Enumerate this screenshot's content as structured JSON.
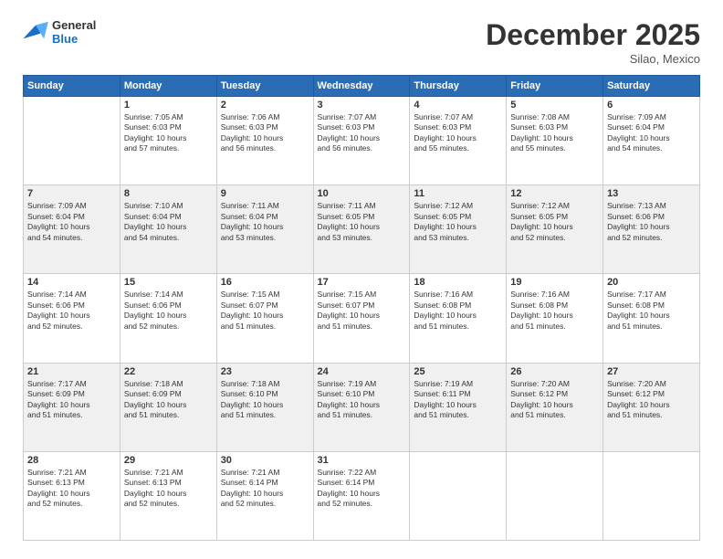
{
  "header": {
    "logo_text_general": "General",
    "logo_text_blue": "Blue",
    "month_title": "December 2025",
    "location": "Silao, Mexico"
  },
  "days_of_week": [
    "Sunday",
    "Monday",
    "Tuesday",
    "Wednesday",
    "Thursday",
    "Friday",
    "Saturday"
  ],
  "weeks": [
    [
      {
        "day": "",
        "info": ""
      },
      {
        "day": "1",
        "info": "Sunrise: 7:05 AM\nSunset: 6:03 PM\nDaylight: 10 hours\nand 57 minutes."
      },
      {
        "day": "2",
        "info": "Sunrise: 7:06 AM\nSunset: 6:03 PM\nDaylight: 10 hours\nand 56 minutes."
      },
      {
        "day": "3",
        "info": "Sunrise: 7:07 AM\nSunset: 6:03 PM\nDaylight: 10 hours\nand 56 minutes."
      },
      {
        "day": "4",
        "info": "Sunrise: 7:07 AM\nSunset: 6:03 PM\nDaylight: 10 hours\nand 55 minutes."
      },
      {
        "day": "5",
        "info": "Sunrise: 7:08 AM\nSunset: 6:03 PM\nDaylight: 10 hours\nand 55 minutes."
      },
      {
        "day": "6",
        "info": "Sunrise: 7:09 AM\nSunset: 6:04 PM\nDaylight: 10 hours\nand 54 minutes."
      }
    ],
    [
      {
        "day": "7",
        "info": "Sunrise: 7:09 AM\nSunset: 6:04 PM\nDaylight: 10 hours\nand 54 minutes."
      },
      {
        "day": "8",
        "info": "Sunrise: 7:10 AM\nSunset: 6:04 PM\nDaylight: 10 hours\nand 54 minutes."
      },
      {
        "day": "9",
        "info": "Sunrise: 7:11 AM\nSunset: 6:04 PM\nDaylight: 10 hours\nand 53 minutes."
      },
      {
        "day": "10",
        "info": "Sunrise: 7:11 AM\nSunset: 6:05 PM\nDaylight: 10 hours\nand 53 minutes."
      },
      {
        "day": "11",
        "info": "Sunrise: 7:12 AM\nSunset: 6:05 PM\nDaylight: 10 hours\nand 53 minutes."
      },
      {
        "day": "12",
        "info": "Sunrise: 7:12 AM\nSunset: 6:05 PM\nDaylight: 10 hours\nand 52 minutes."
      },
      {
        "day": "13",
        "info": "Sunrise: 7:13 AM\nSunset: 6:06 PM\nDaylight: 10 hours\nand 52 minutes."
      }
    ],
    [
      {
        "day": "14",
        "info": "Sunrise: 7:14 AM\nSunset: 6:06 PM\nDaylight: 10 hours\nand 52 minutes."
      },
      {
        "day": "15",
        "info": "Sunrise: 7:14 AM\nSunset: 6:06 PM\nDaylight: 10 hours\nand 52 minutes."
      },
      {
        "day": "16",
        "info": "Sunrise: 7:15 AM\nSunset: 6:07 PM\nDaylight: 10 hours\nand 51 minutes."
      },
      {
        "day": "17",
        "info": "Sunrise: 7:15 AM\nSunset: 6:07 PM\nDaylight: 10 hours\nand 51 minutes."
      },
      {
        "day": "18",
        "info": "Sunrise: 7:16 AM\nSunset: 6:08 PM\nDaylight: 10 hours\nand 51 minutes."
      },
      {
        "day": "19",
        "info": "Sunrise: 7:16 AM\nSunset: 6:08 PM\nDaylight: 10 hours\nand 51 minutes."
      },
      {
        "day": "20",
        "info": "Sunrise: 7:17 AM\nSunset: 6:08 PM\nDaylight: 10 hours\nand 51 minutes."
      }
    ],
    [
      {
        "day": "21",
        "info": "Sunrise: 7:17 AM\nSunset: 6:09 PM\nDaylight: 10 hours\nand 51 minutes."
      },
      {
        "day": "22",
        "info": "Sunrise: 7:18 AM\nSunset: 6:09 PM\nDaylight: 10 hours\nand 51 minutes."
      },
      {
        "day": "23",
        "info": "Sunrise: 7:18 AM\nSunset: 6:10 PM\nDaylight: 10 hours\nand 51 minutes."
      },
      {
        "day": "24",
        "info": "Sunrise: 7:19 AM\nSunset: 6:10 PM\nDaylight: 10 hours\nand 51 minutes."
      },
      {
        "day": "25",
        "info": "Sunrise: 7:19 AM\nSunset: 6:11 PM\nDaylight: 10 hours\nand 51 minutes."
      },
      {
        "day": "26",
        "info": "Sunrise: 7:20 AM\nSunset: 6:12 PM\nDaylight: 10 hours\nand 51 minutes."
      },
      {
        "day": "27",
        "info": "Sunrise: 7:20 AM\nSunset: 6:12 PM\nDaylight: 10 hours\nand 51 minutes."
      }
    ],
    [
      {
        "day": "28",
        "info": "Sunrise: 7:21 AM\nSunset: 6:13 PM\nDaylight: 10 hours\nand 52 minutes."
      },
      {
        "day": "29",
        "info": "Sunrise: 7:21 AM\nSunset: 6:13 PM\nDaylight: 10 hours\nand 52 minutes."
      },
      {
        "day": "30",
        "info": "Sunrise: 7:21 AM\nSunset: 6:14 PM\nDaylight: 10 hours\nand 52 minutes."
      },
      {
        "day": "31",
        "info": "Sunrise: 7:22 AM\nSunset: 6:14 PM\nDaylight: 10 hours\nand 52 minutes."
      },
      {
        "day": "",
        "info": ""
      },
      {
        "day": "",
        "info": ""
      },
      {
        "day": "",
        "info": ""
      }
    ]
  ]
}
